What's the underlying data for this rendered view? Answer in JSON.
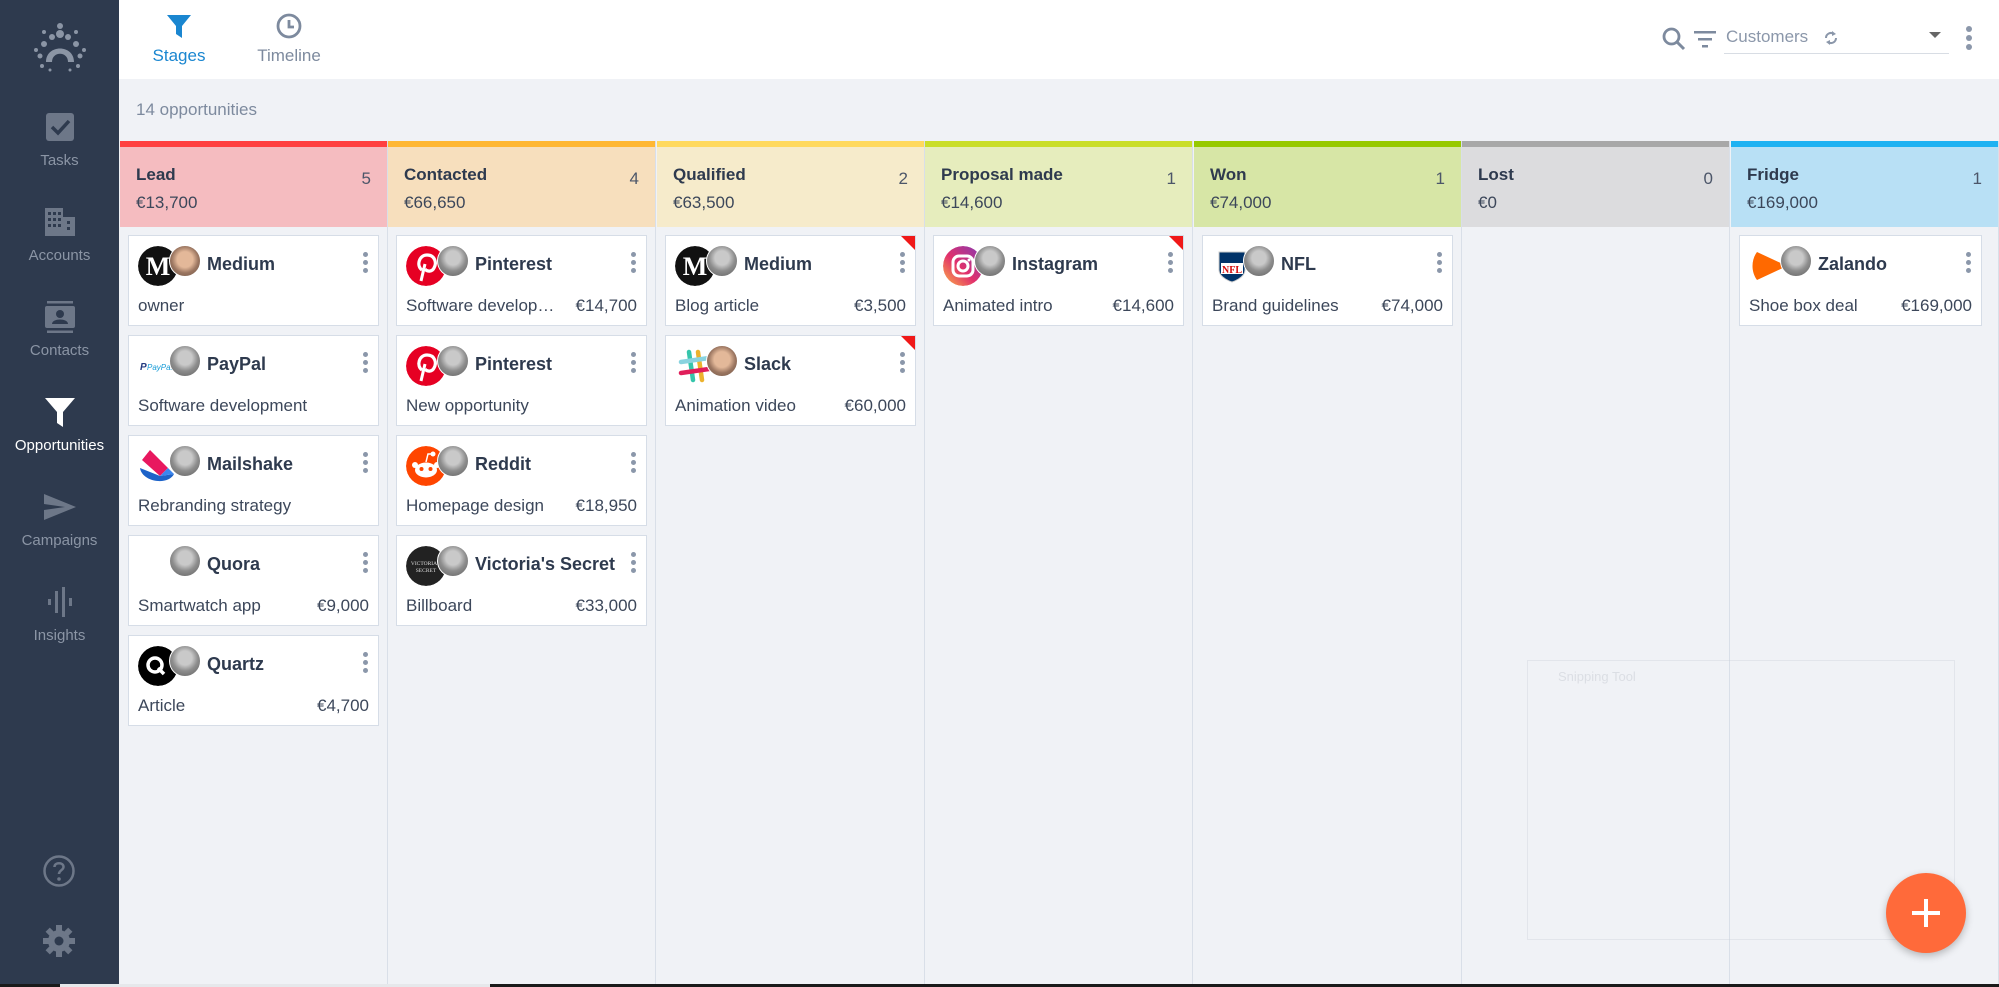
{
  "sidebar": {
    "items": [
      {
        "label": "Tasks",
        "icon": "tasks-check-icon",
        "active": false
      },
      {
        "label": "Accounts",
        "icon": "accounts-building-icon",
        "active": false
      },
      {
        "label": "Contacts",
        "icon": "contacts-card-icon",
        "active": false
      },
      {
        "label": "Opportunities",
        "icon": "funnel-icon",
        "active": true
      },
      {
        "label": "Campaigns",
        "icon": "send-icon",
        "active": false
      },
      {
        "label": "Insights",
        "icon": "insights-bars-icon",
        "active": false
      }
    ],
    "bottom": [
      {
        "icon": "help-icon"
      },
      {
        "icon": "settings-gear-icon"
      }
    ]
  },
  "topbar": {
    "tabs": [
      {
        "label": "Stages",
        "icon": "funnel-icon",
        "active": true
      },
      {
        "label": "Timeline",
        "icon": "clock-icon",
        "active": false
      }
    ],
    "segment": {
      "value": "Customers"
    }
  },
  "summary": {
    "count_label": "14 opportunities"
  },
  "colors": {
    "accent": "#1a86d0",
    "sidebar_bg": "#2e3a4e",
    "fab": "#ff6a3a",
    "flag": "#f01818"
  },
  "stages": [
    {
      "name": "Lead",
      "count": "5",
      "total": "€13,700",
      "bar": "#ff4040",
      "bg": "#f5bcc0",
      "cards": [
        {
          "company": "Medium",
          "desc": "owner",
          "amount": "",
          "logo": "medium",
          "avatar": "male",
          "flag": false
        },
        {
          "company": "PayPal",
          "desc": "Software development",
          "amount": "",
          "logo": "paypal",
          "avatar": "female",
          "flag": false
        },
        {
          "company": "Mailshake",
          "desc": "Rebranding strategy",
          "amount": "",
          "logo": "mailshake",
          "avatar": "female",
          "flag": false
        },
        {
          "company": "Quora",
          "desc": "Smartwatch app",
          "amount": "€9,000",
          "logo": "none",
          "avatar": "female",
          "flag": false
        },
        {
          "company": "Quartz",
          "desc": "Article",
          "amount": "€4,700",
          "logo": "quartz",
          "avatar": "female",
          "flag": false
        }
      ]
    },
    {
      "name": "Contacted",
      "count": "4",
      "total": "€66,650",
      "bar": "#ffb733",
      "bg": "#f7dfbd",
      "cards": [
        {
          "company": "Pinterest",
          "desc": "Software development",
          "amount": "€14,700",
          "logo": "pinterest",
          "avatar": "female",
          "flag": false
        },
        {
          "company": "Pinterest",
          "desc": "New opportunity",
          "amount": "",
          "logo": "pinterest",
          "avatar": "female",
          "flag": false
        },
        {
          "company": "Reddit",
          "desc": "Homepage design",
          "amount": "€18,950",
          "logo": "reddit",
          "avatar": "female",
          "flag": false
        },
        {
          "company": "Victoria's Secret",
          "desc": "Billboard",
          "amount": "€33,000",
          "logo": "victoria",
          "avatar": "female",
          "flag": false
        }
      ]
    },
    {
      "name": "Qualified",
      "count": "2",
      "total": "€63,500",
      "bar": "#ffd95e",
      "bg": "#f6ebcb",
      "cards": [
        {
          "company": "Medium",
          "desc": "Blog article",
          "amount": "€3,500",
          "logo": "medium",
          "avatar": "female",
          "flag": true
        },
        {
          "company": "Slack",
          "desc": "Animation video",
          "amount": "€60,000",
          "logo": "slack",
          "avatar": "male",
          "flag": true
        }
      ]
    },
    {
      "name": "Proposal made",
      "count": "1",
      "total": "€14,600",
      "bar": "#cade2a",
      "bg": "#e6edbd",
      "cards": [
        {
          "company": "Instagram",
          "desc": "Animated intro",
          "amount": "€14,600",
          "logo": "instagram",
          "avatar": "female",
          "flag": true
        }
      ]
    },
    {
      "name": "Won",
      "count": "1",
      "total": "€74,000",
      "bar": "#97c900",
      "bg": "#d7e6a6",
      "cards": [
        {
          "company": "NFL",
          "desc": "Brand guidelines",
          "amount": "€74,000",
          "logo": "nfl",
          "avatar": "female",
          "flag": false
        }
      ]
    },
    {
      "name": "Lost",
      "count": "0",
      "total": "€0",
      "bar": "#a8a8a8",
      "bg": "#dcdcde",
      "cards": []
    },
    {
      "name": "Fridge",
      "count": "1",
      "total": "€169,000",
      "bar": "#1eb2f2",
      "bg": "#b8e0f5",
      "cards": [
        {
          "company": "Zalando",
          "desc": "Shoe box deal",
          "amount": "€169,000",
          "logo": "zalando",
          "avatar": "female",
          "flag": false
        }
      ]
    }
  ],
  "overlay": {
    "label": "Snipping Tool"
  },
  "fab": {
    "icon": "plus-icon",
    "label": "Add opportunity"
  }
}
